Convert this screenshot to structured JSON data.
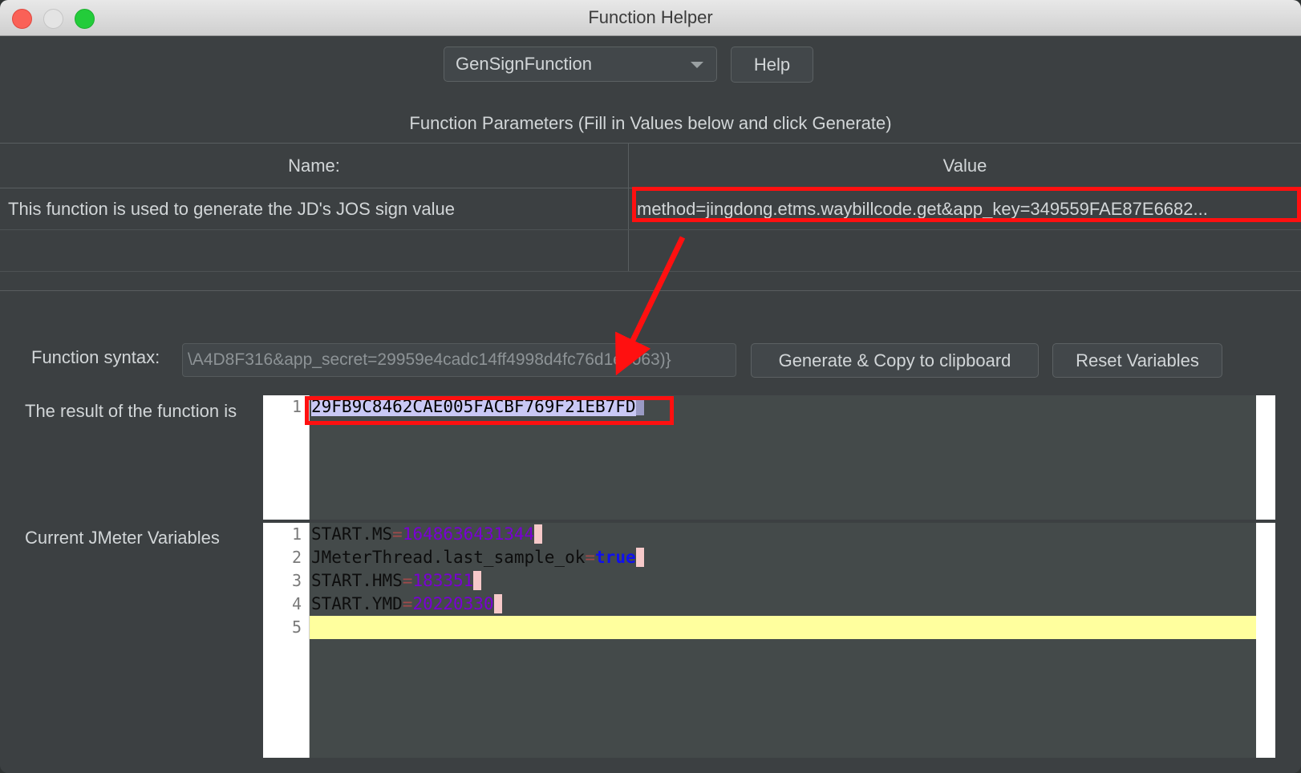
{
  "window": {
    "title": "Function Helper",
    "controls": {
      "close": "close-button",
      "minimize": "minimize-button",
      "maximize": "maximize-button"
    }
  },
  "toolbar": {
    "function_selected": "GenSignFunction",
    "function_options": [
      "GenSignFunction"
    ],
    "help_label": "Help"
  },
  "parameters": {
    "caption": "Function Parameters (Fill in Values below and click Generate)",
    "columns": [
      "Name:",
      "Value"
    ],
    "rows": [
      {
        "name": "This function is used to generate the JD's JOS sign value",
        "value": "method=jingdong.etms.waybillcode.get&app_key=349559FAE87E6682..."
      },
      {
        "name": "",
        "value": ""
      }
    ]
  },
  "syntax": {
    "label": "Function syntax:",
    "value": "\\A4D8F316&app_secret=29959e4cadc14ff4998d4fc76d1e5063)}"
  },
  "actions": {
    "generate_label": "Generate & Copy to clipboard",
    "reset_label": "Reset Variables"
  },
  "result": {
    "label": "The result of the function is",
    "line_numbers": [
      "1"
    ],
    "text": "29FB9C8462CAE005FACBF769F21EB7FD"
  },
  "variables": {
    "label": "Current JMeter Variables",
    "line_numbers": [
      "1",
      "2",
      "3",
      "4",
      "5"
    ],
    "rows": [
      {
        "key": "START.MS",
        "eq": "=",
        "value": "1648636431344",
        "kind": "num"
      },
      {
        "key": "JMeterThread.last_sample_ok",
        "eq": "=",
        "value": "true",
        "kind": "bool"
      },
      {
        "key": "START.HMS",
        "eq": "=",
        "value": "183351",
        "kind": "num"
      },
      {
        "key": "START.YMD",
        "eq": "=",
        "value": "20220330",
        "kind": "num"
      },
      {
        "key": "",
        "eq": "",
        "value": "",
        "kind": "empty"
      }
    ]
  },
  "annotations": {
    "highlight_color": "#ff1010",
    "arrow_from": "parameter value cell",
    "arrow_to": "result text"
  },
  "colors": {
    "window_bg": "#3c4042",
    "editor_bg": "#444a4a",
    "titlebar_bg": "#dcdcdc",
    "text": "#d2d6d8",
    "selection": "#c9c8f5",
    "current_line": "#ffff9e",
    "number_token": "#7a00d4",
    "bool_token": "#1010ee",
    "eol_marker": "#f6c9c9"
  }
}
